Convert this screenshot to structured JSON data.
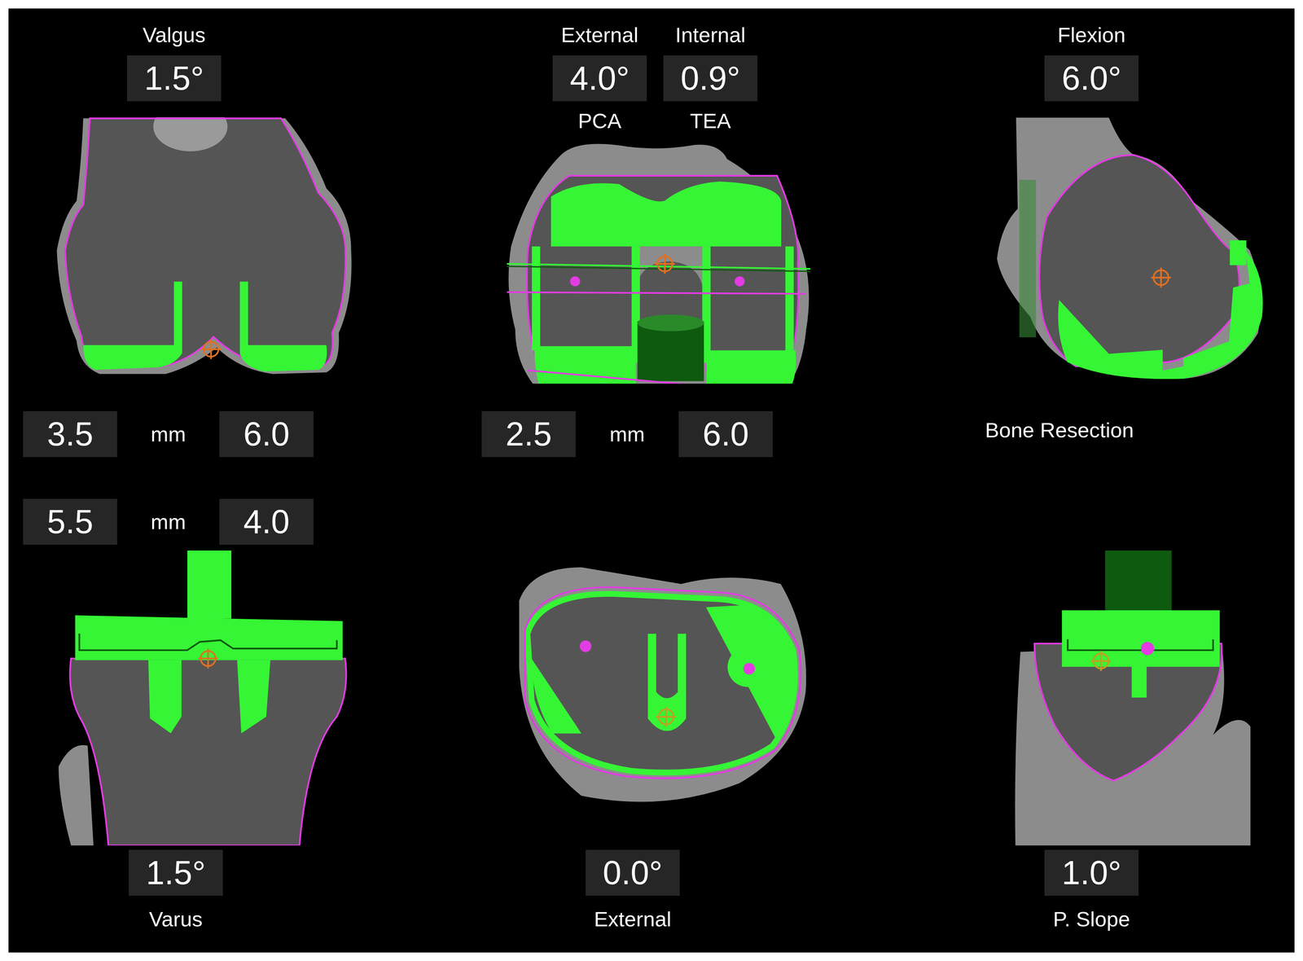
{
  "femur": {
    "coronal": {
      "label": "Valgus",
      "angle": "1.5°"
    },
    "rotation": [
      {
        "label": "External",
        "angle": "4.0°",
        "axis": "PCA"
      },
      {
        "label": "Internal",
        "angle": "0.9°",
        "axis": "TEA"
      }
    ],
    "sagittal": {
      "label": "Flexion",
      "angle": "6.0°"
    },
    "distal_resection": {
      "left": "3.5",
      "unit": "mm",
      "right": "6.0"
    },
    "posterior_resection": {
      "left": "2.5",
      "unit": "mm",
      "right": "6.0"
    }
  },
  "bone_resection_label": "Bone Resection",
  "tibia": {
    "resection": {
      "left": "5.5",
      "unit": "mm",
      "right": "4.0"
    },
    "coronal": {
      "label": "Varus",
      "angle": "1.5°"
    },
    "rotation": {
      "label": "External",
      "angle": "0.0°"
    },
    "slope": {
      "label": "P. Slope",
      "angle": "1.0°"
    }
  }
}
